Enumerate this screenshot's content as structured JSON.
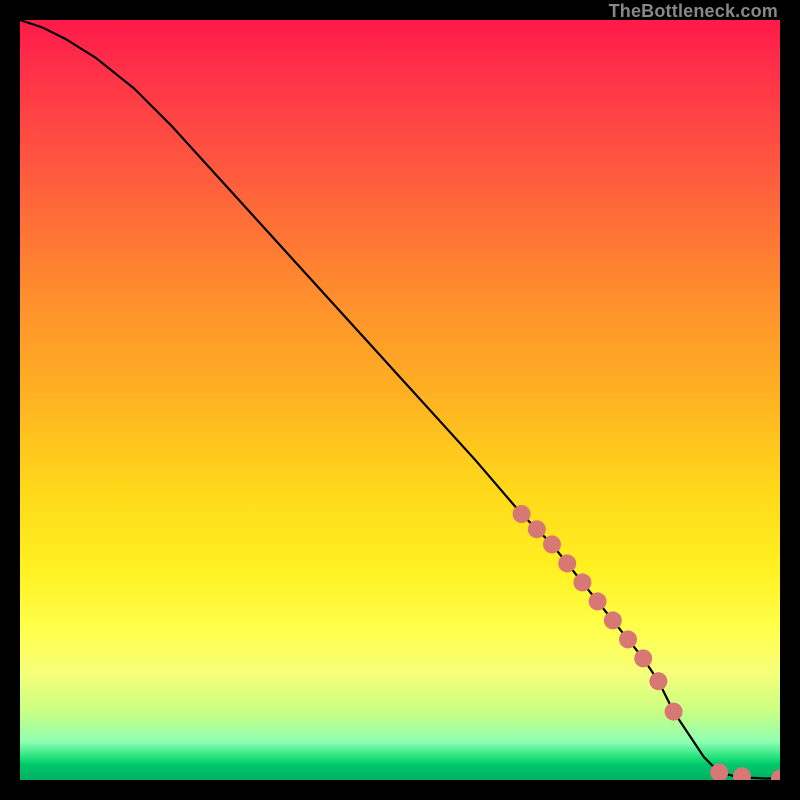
{
  "attribution": "TheBottleneck.com",
  "colors": {
    "frame": "#000000",
    "line": "#000000",
    "marker_fill": "#d77874",
    "gradient_stops": [
      "#ff1a4b",
      "#ff3547",
      "#ff5a3e",
      "#ff8a2e",
      "#ffb321",
      "#ffd91a",
      "#fff021",
      "#ffff4a",
      "#f6ff7a",
      "#c9ff82",
      "#8dffb3",
      "#24e27a",
      "#00c76b",
      "#00b060"
    ]
  },
  "chart_data": {
    "type": "line",
    "title": "",
    "xlabel": "",
    "ylabel": "",
    "xlim": [
      0,
      100
    ],
    "ylim": [
      0,
      100
    ],
    "series": [
      {
        "name": "curve",
        "x": [
          0,
          3,
          6,
          10,
          15,
          20,
          30,
          40,
          50,
          60,
          66,
          68,
          70,
          72,
          74,
          76,
          78,
          80,
          82,
          84,
          85,
          86,
          88,
          90,
          92,
          94,
          96,
          98,
          100
        ],
        "y": [
          100,
          99,
          97.5,
          95,
          91,
          86,
          75,
          64,
          53,
          42,
          35,
          33,
          31,
          28.5,
          26,
          23.5,
          21,
          18.5,
          16,
          13,
          11,
          9,
          6,
          3,
          1,
          0.5,
          0.3,
          0.2,
          0.2
        ]
      }
    ],
    "markers": {
      "name": "highlighted-points",
      "x": [
        66,
        68,
        70,
        72,
        74,
        76,
        78,
        80,
        82,
        84,
        86,
        92,
        95,
        100
      ],
      "y": [
        35,
        33,
        31,
        28.5,
        26,
        23.5,
        21,
        18.5,
        16,
        13,
        9,
        1,
        0.5,
        0.2
      ]
    }
  }
}
